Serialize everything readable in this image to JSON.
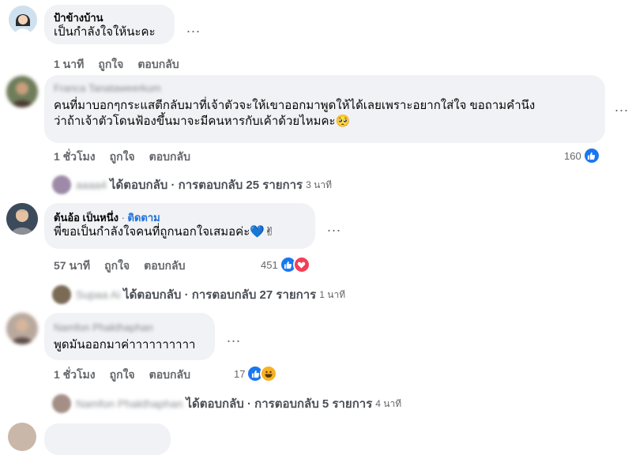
{
  "comments": [
    {
      "name": "ป้าข้างบ้าน",
      "text": "เป็นกำลังใจให้นะคะ",
      "time": "1 นาที",
      "like": "ถูกใจ",
      "reply": "ตอบกลับ",
      "more": "..."
    },
    {
      "name": "Franca Tanataweerkum",
      "text_line1": "คนที่มาบอกๆกระแสตีกลับมาที่เจ้าตัวจะให้เขาออกมาพูดให้ได้เลยเพราะอยากใส่ใจ ขอถามคำนึง",
      "text_line2": "ว่าถ้าเจ้าตัวโดนฟ้องขึ้นมาจะมีคนหารกับเค้าด้วยไหมคะ",
      "emoji": "🥺",
      "time": "1 ชั่วโมง",
      "like": "ถูกใจ",
      "reply": "ตอบกลับ",
      "reaction_count": "160",
      "more": "...",
      "replies": {
        "replier": "aaaa4",
        "label": "ได้ตอบกลับ",
        "sep": "·",
        "count_text": "การตอบกลับ 25 รายการ",
        "ago": "3 นาที"
      }
    },
    {
      "name": "ต้นอ้อ เป็นหนึ่ง",
      "follow_sep": "·",
      "follow": "ติดตาม",
      "text": "พี่ขอเป็นกำลังใจคนที่ถูกนอกใจเสมอค่ะ",
      "emoji": "💙✌",
      "time": "57 นาที",
      "like": "ถูกใจ",
      "reply": "ตอบกลับ",
      "reaction_count": "451",
      "more": "...",
      "replies": {
        "replier": "Supaa Ai",
        "label": "ได้ตอบกลับ",
        "sep": "·",
        "count_text": "การตอบกลับ 27 รายการ",
        "ago": "1 นาที"
      }
    },
    {
      "name": "Namfon Phakthaphan",
      "text": "พูดมันออกมาค่าาาาาาาาาา",
      "time": "1 ชั่วโมง",
      "like": "ถูกใจ",
      "reply": "ตอบกลับ",
      "reaction_count": "17",
      "more": "...",
      "replies": {
        "replier": "Namfon Phakthaphan",
        "label": "ได้ตอบกลับ",
        "sep": "·",
        "count_text": "การตอบกลับ 5 รายการ",
        "ago": "4 นาที"
      }
    }
  ],
  "colors": {
    "bubble": "#f0f2f5",
    "like_blue": "#1877f2",
    "love_red": "#f33e58",
    "haha_yellow": "#f7b125",
    "follow_blue": "#216fdb"
  }
}
